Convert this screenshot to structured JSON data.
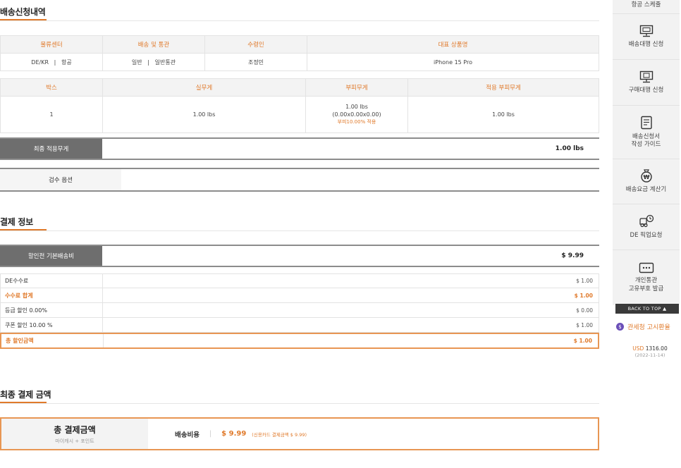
{
  "shipping_request": {
    "title": "배송신청내역",
    "table1": {
      "headers": [
        "물류센터",
        "배송 및 통관",
        "수령인",
        "대표 상품명"
      ],
      "row": {
        "center": "DE/KR",
        "center_type": "항공",
        "ship_type": "일반",
        "customs_type": "일반통관",
        "recipient": "조정민",
        "product": "iPhone 15 Pro"
      }
    },
    "table2": {
      "headers": [
        "박스",
        "실무게",
        "부피무게",
        "적용 부피무게"
      ],
      "row": {
        "box": "1",
        "actual_weight": "1.00 lbs",
        "volume_weight": "1.00 lbs",
        "volume_dims": "(0.00x0.00x0.00)",
        "volume_note": "부피10.00% 적용",
        "applied_weight": "1.00 lbs"
      }
    },
    "final_weight_label": "최종 적용무게",
    "final_weight_value": "1.00 lbs",
    "inspection_label": "검수 옵션"
  },
  "payment_info": {
    "title": "결제 정보",
    "base_fee_label": "할인전 기본배송비",
    "base_fee_value": "$ 9.99",
    "rows": [
      {
        "label": "DE수수료",
        "value": "$ 1.00"
      },
      {
        "label": "수수료 합계",
        "value": "$ 1.00"
      },
      {
        "label": "등급 할인 0.00%",
        "value": "$ 0.00"
      },
      {
        "label": "쿠폰 할인 10.00 %",
        "value": "$ 1.00"
      },
      {
        "label": "총 할인금액",
        "value": "$ 1.00"
      }
    ]
  },
  "final_payment": {
    "title": "최종 결제 금액",
    "total_label": "총 결제금액",
    "total_sub": "마이캐시 + 포인트",
    "shipping_label": "배송비용",
    "shipping_amount": "$ 9.99",
    "shipping_note": "(신용카드 결제금액 $ 9.99)"
  },
  "sidebar": {
    "top_item": "항공 스케줄",
    "items": [
      {
        "label": "배송대행 신청",
        "icon": "monitor-icon"
      },
      {
        "label": "구매대행 신청",
        "icon": "desktop-icon"
      },
      {
        "label": "배송신청서\n작성 가이드",
        "icon": "document-icon"
      },
      {
        "label": "배송요금 계산기",
        "icon": "money-bag-icon"
      },
      {
        "label": "DE 픽업요청",
        "icon": "truck-icon"
      },
      {
        "label": "개인통관\n고유부호 발급",
        "icon": "id-card-icon"
      }
    ],
    "back_to_top": "BACK TO TOP ▲",
    "customs_label": "관세청 고시환율",
    "customs_icon_text": "$",
    "rate_currency": "USD",
    "rate_value": "1316.00",
    "rate_date": "(2022-11-14)"
  }
}
